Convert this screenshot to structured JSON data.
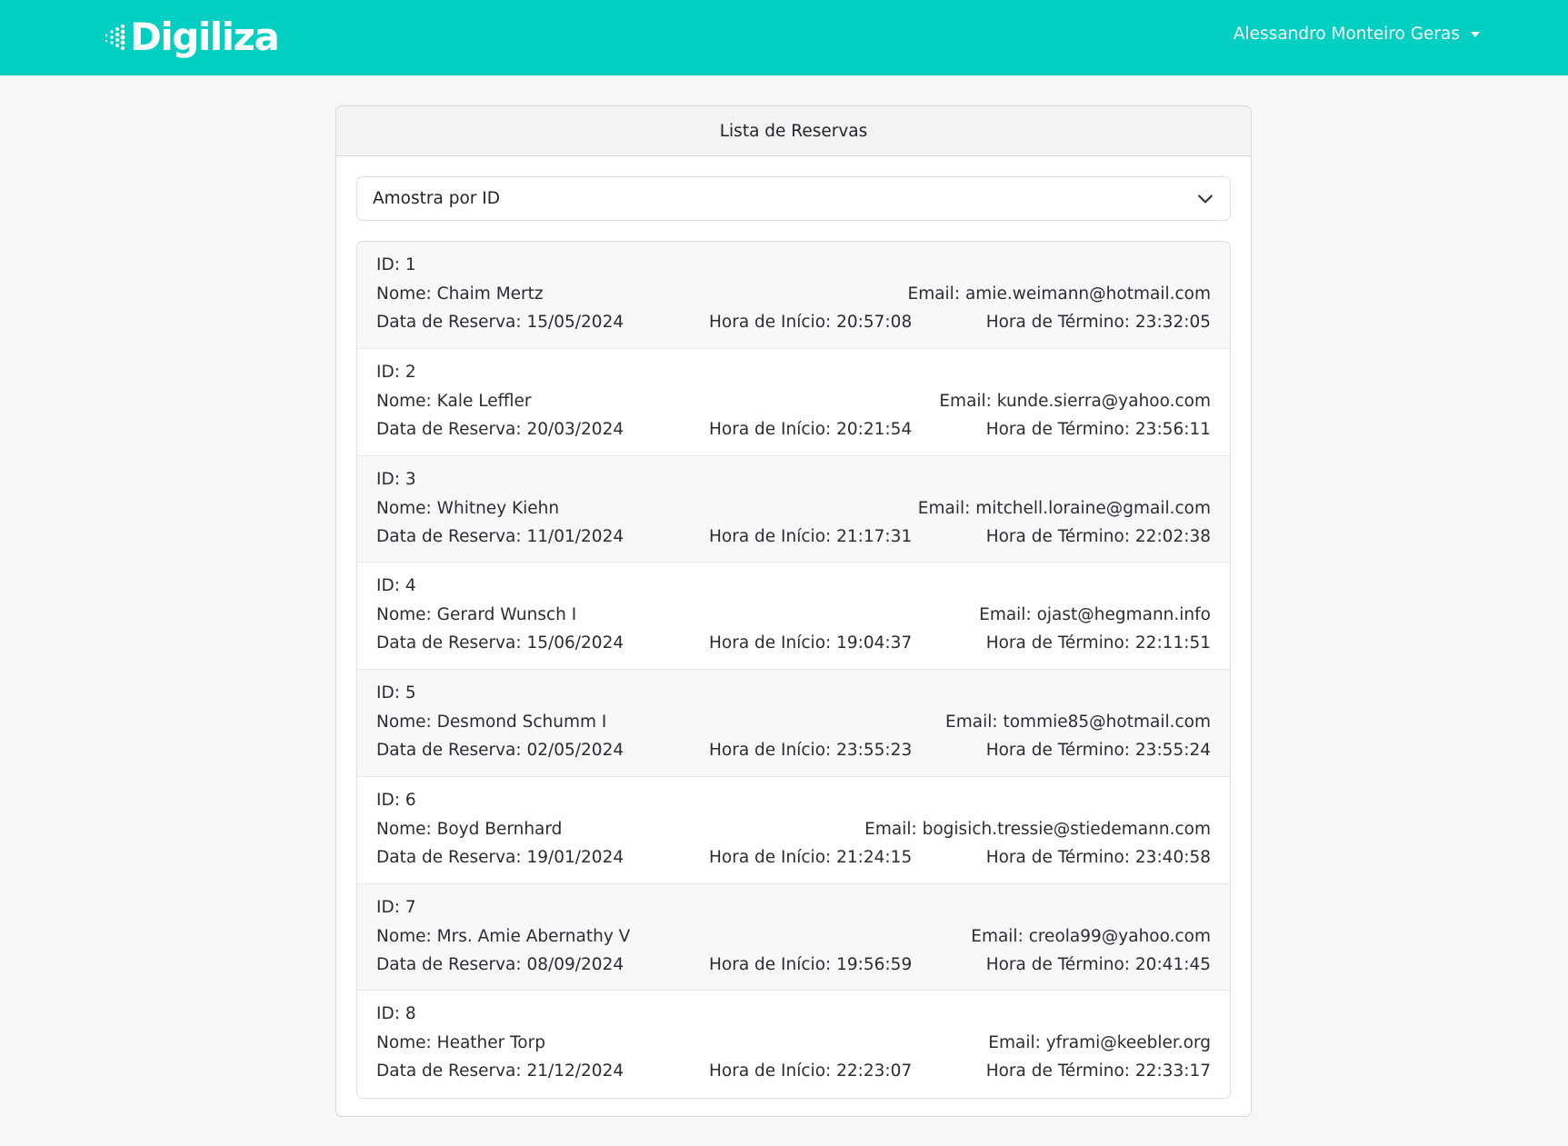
{
  "navbar": {
    "brand": "Digiliza",
    "user_name": "Alessandro Monteiro Geras",
    "brand_color": "#00cfc1"
  },
  "card": {
    "title": "Lista de Reservas"
  },
  "sort_select": {
    "selected": "Amostra por ID"
  },
  "reservations": [
    {
      "id": "ID: 1",
      "name": "Nome: Chaim Mertz",
      "email": "Email: amie.weimann@hotmail.com",
      "date": "Data de Reserva: 15/05/2024",
      "start": "Hora de Início: 20:57:08",
      "end": "Hora de Término: 23:32:05"
    },
    {
      "id": "ID: 2",
      "name": "Nome: Kale Leffler",
      "email": "Email: kunde.sierra@yahoo.com",
      "date": "Data de Reserva: 20/03/2024",
      "start": "Hora de Início: 20:21:54",
      "end": "Hora de Término: 23:56:11"
    },
    {
      "id": "ID: 3",
      "name": "Nome: Whitney Kiehn",
      "email": "Email: mitchell.loraine@gmail.com",
      "date": "Data de Reserva: 11/01/2024",
      "start": "Hora de Início: 21:17:31",
      "end": "Hora de Término: 22:02:38"
    },
    {
      "id": "ID: 4",
      "name": "Nome: Gerard Wunsch I",
      "email": "Email: ojast@hegmann.info",
      "date": "Data de Reserva: 15/06/2024",
      "start": "Hora de Início: 19:04:37",
      "end": "Hora de Término: 22:11:51"
    },
    {
      "id": "ID: 5",
      "name": "Nome: Desmond Schumm I",
      "email": "Email: tommie85@hotmail.com",
      "date": "Data de Reserva: 02/05/2024",
      "start": "Hora de Início: 23:55:23",
      "end": "Hora de Término: 23:55:24"
    },
    {
      "id": "ID: 6",
      "name": "Nome: Boyd Bernhard",
      "email": "Email: bogisich.tressie@stiedemann.com",
      "date": "Data de Reserva: 19/01/2024",
      "start": "Hora de Início: 21:24:15",
      "end": "Hora de Término: 23:40:58"
    },
    {
      "id": "ID: 7",
      "name": "Nome: Mrs. Amie Abernathy V",
      "email": "Email: creola99@yahoo.com",
      "date": "Data de Reserva: 08/09/2024",
      "start": "Hora de Início: 19:56:59",
      "end": "Hora de Término: 20:41:45"
    },
    {
      "id": "ID: 8",
      "name": "Nome: Heather Torp",
      "email": "Email: yframi@keebler.org",
      "date": "Data de Reserva: 21/12/2024",
      "start": "Hora de Início: 22:23:07",
      "end": "Hora de Término: 22:33:17"
    }
  ],
  "icons": {
    "brand_logo": "dots-logo-icon",
    "user_caret": "caret-down-icon",
    "select_chevron": "chevron-down-icon"
  }
}
